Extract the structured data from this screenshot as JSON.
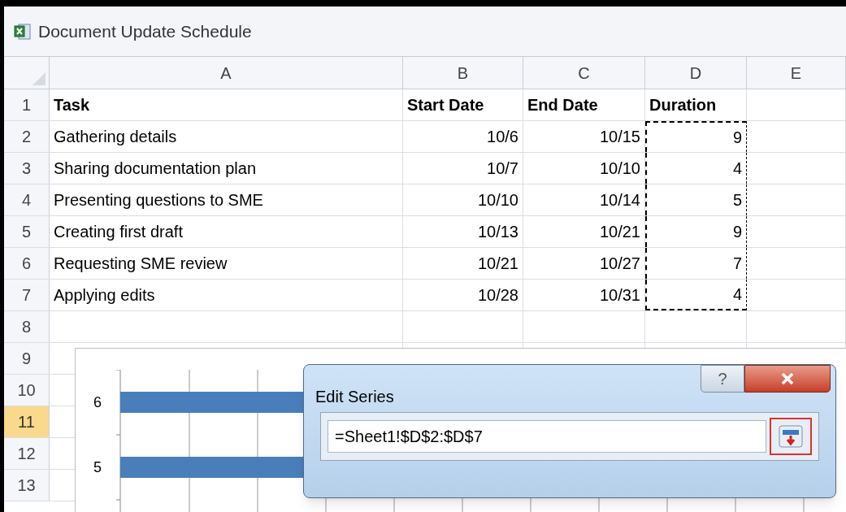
{
  "window": {
    "title": "Document Update Schedule"
  },
  "columns": [
    "A",
    "B",
    "C",
    "D",
    "E"
  ],
  "rows": [
    {
      "number": "1",
      "kind": "header",
      "selected": false,
      "in_copy_range": false,
      "cells": [
        "Task",
        "Start Date",
        "End Date",
        "Duration"
      ]
    },
    {
      "number": "2",
      "kind": "data",
      "selected": false,
      "in_copy_range": true,
      "cells": [
        "Gathering details",
        "10/6",
        "10/15",
        "9"
      ]
    },
    {
      "number": "3",
      "kind": "data",
      "selected": false,
      "in_copy_range": true,
      "cells": [
        "Sharing documentation plan",
        "10/7",
        "10/10",
        "4"
      ]
    },
    {
      "number": "4",
      "kind": "data",
      "selected": false,
      "in_copy_range": true,
      "cells": [
        "Presenting questions to SME",
        "10/10",
        "10/14",
        "5"
      ]
    },
    {
      "number": "5",
      "kind": "data",
      "selected": false,
      "in_copy_range": true,
      "cells": [
        "Creating first draft",
        "10/13",
        "10/21",
        "9"
      ]
    },
    {
      "number": "6",
      "kind": "data",
      "selected": false,
      "in_copy_range": true,
      "cells": [
        "Requesting SME review",
        "10/21",
        "10/27",
        "7"
      ]
    },
    {
      "number": "7",
      "kind": "data",
      "selected": false,
      "in_copy_range": true,
      "cells": [
        "Applying edits",
        "10/28",
        "10/31",
        "4"
      ]
    },
    {
      "number": "8",
      "kind": "empty",
      "selected": false,
      "in_copy_range": false
    },
    {
      "number": "9",
      "kind": "empty",
      "selected": false
    },
    {
      "number": "10",
      "kind": "empty",
      "selected": false
    },
    {
      "number": "11",
      "kind": "empty",
      "selected": true
    },
    {
      "number": "12",
      "kind": "empty",
      "selected": false
    },
    {
      "number": "13",
      "kind": "empty",
      "selected": false
    }
  ],
  "chart": {
    "category_labels": [
      "6",
      "5"
    ]
  },
  "dialog": {
    "title": "Edit Series",
    "help_button": "?",
    "range_field": {
      "value": "=Sheet1!$D$2:$D$7"
    },
    "collapse_button": {
      "highlighted": true
    }
  }
}
